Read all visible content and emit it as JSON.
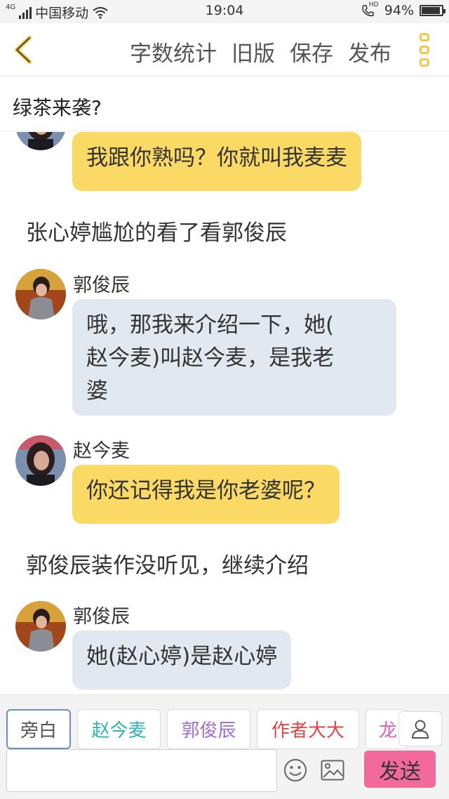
{
  "status_bar": {
    "network": "4G",
    "carrier": "中国移动",
    "time": "19:04",
    "hd_label": "HD",
    "battery_text": "94%",
    "battery_level": 0.94
  },
  "toolbar": {
    "word_count": "字数统计",
    "old_version": "旧版",
    "save": "保存",
    "publish": "发布",
    "accent_color": "#f2c744"
  },
  "document": {
    "title": "绿茶来袭?"
  },
  "chat": {
    "messages": [
      {
        "type": "bubble",
        "speaker": "",
        "text": "我跟你熟吗？你就叫我麦麦",
        "color": "yellow"
      },
      {
        "type": "narration",
        "text": "张心婷尴尬的看了看郭俊辰"
      },
      {
        "type": "bubble",
        "speaker": "郭俊辰",
        "text_lines": [
          "哦，那我来介绍一下，她(",
          "赵今麦)叫赵今麦，是我老",
          "婆"
        ],
        "color": "blue"
      },
      {
        "type": "bubble",
        "speaker": "赵今麦",
        "text": "你还记得我是你老婆呢？",
        "color": "yellow"
      },
      {
        "type": "narration",
        "text": "郭俊辰装作没听见，继续介绍"
      },
      {
        "type": "bubble",
        "speaker": "郭俊辰",
        "text": "她(赵心婷)是赵心婷",
        "color": "blue"
      }
    ]
  },
  "input_bar": {
    "roles": [
      {
        "label": "旁白",
        "color": "#555555"
      },
      {
        "label": "赵今麦",
        "color": "#2fb5b0"
      },
      {
        "label": "郭俊辰",
        "color": "#a070d0"
      },
      {
        "label": "作者大大",
        "color": "#e04444"
      },
      {
        "label": "龙",
        "color": "#e060b0"
      }
    ],
    "message_placeholder": "",
    "send_label": "发送",
    "send_color": "#f26a9a"
  }
}
